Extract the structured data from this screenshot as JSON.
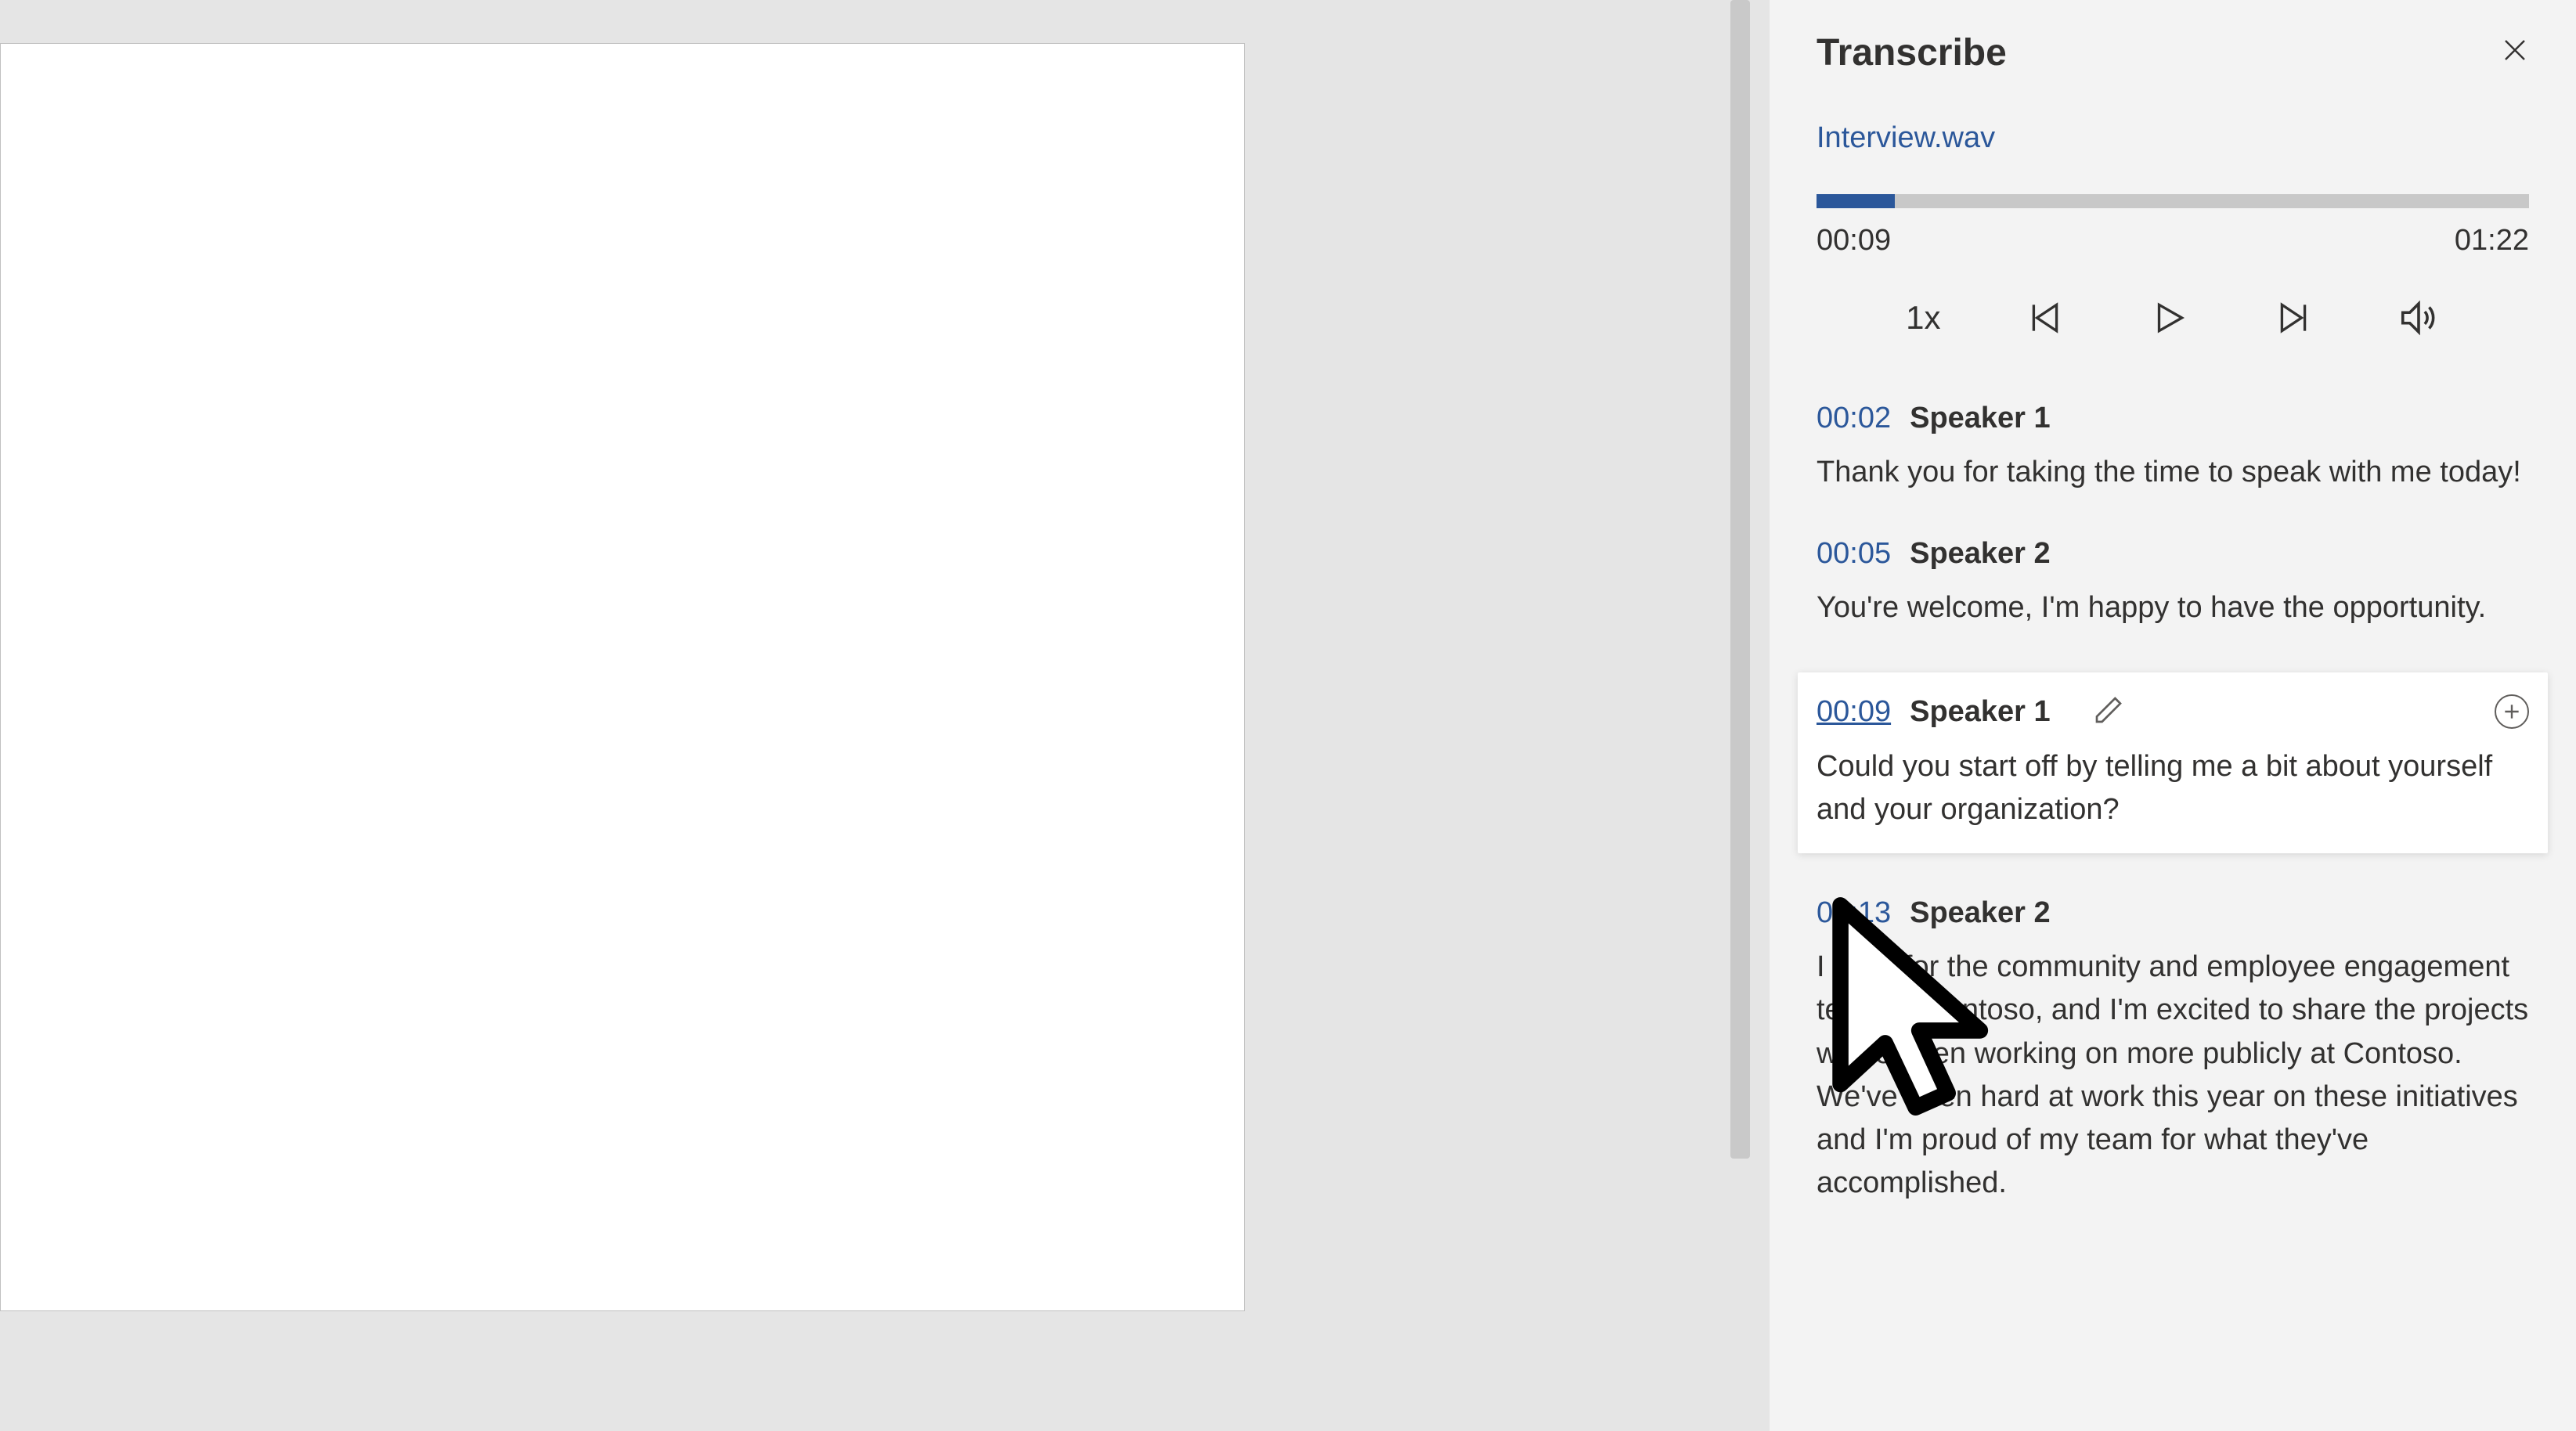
{
  "panel": {
    "title": "Transcribe",
    "filename": "Interview.wav",
    "current_time": "00:09",
    "total_time": "01:22",
    "progress_pct": 11,
    "playback_speed": "1x"
  },
  "segments": [
    {
      "time": "00:02",
      "speaker": "Speaker 1",
      "text": "Thank you for taking the time to speak with me today!",
      "hovered": false
    },
    {
      "time": "00:05",
      "speaker": "Speaker 2",
      "text": "You're welcome, I'm happy to have the opportunity.",
      "hovered": false
    },
    {
      "time": "00:09",
      "speaker": "Speaker 1",
      "text": "Could you start off by telling me a bit about yourself and your organization?",
      "hovered": true
    },
    {
      "time": "00:13",
      "speaker": "Speaker 2",
      "text": "I work for the community and employee engagement team at Contoso, and I'm excited to share the projects we've been working on more publicly at Contoso. We've been hard at work this year on these initiatives and I'm proud of my team for what they've accomplished.",
      "hovered": false
    }
  ]
}
